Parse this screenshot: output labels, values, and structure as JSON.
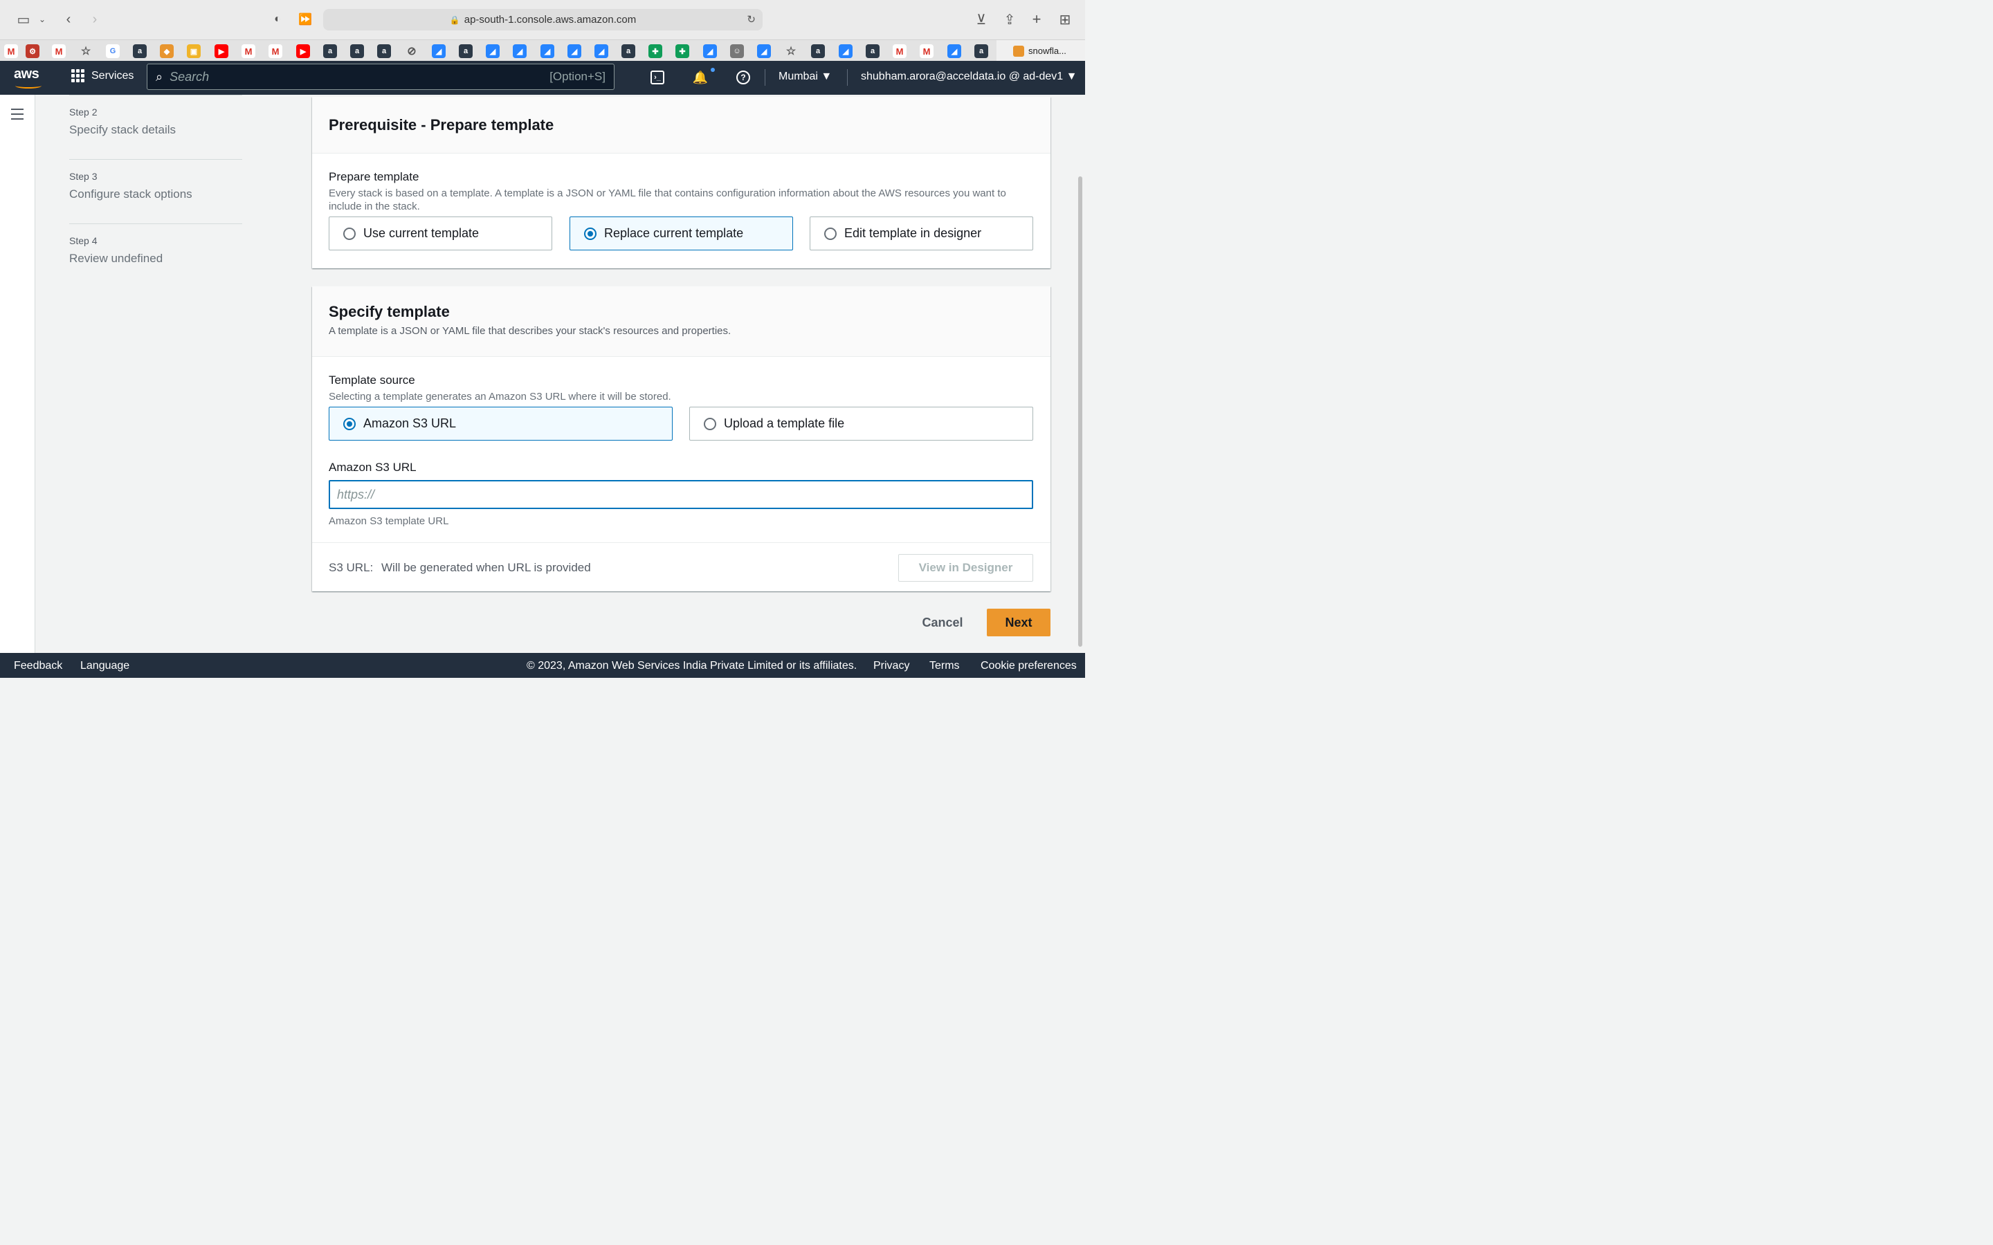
{
  "browser": {
    "url": "ap-south-1.console.aws.amazon.com",
    "active_tab_label": "snowfla..."
  },
  "aws_nav": {
    "logo_text": "aws",
    "services_label": "Services",
    "search_placeholder": "Search",
    "search_shortcut": "[Option+S]",
    "region": "Mumbai ▼",
    "account": "shubham.arora@acceldata.io @ ad-dev1 ▼"
  },
  "steps": [
    {
      "num": "Step 2",
      "title": "Specify stack details"
    },
    {
      "num": "Step 3",
      "title": "Configure stack options"
    },
    {
      "num": "Step 4",
      "title": "Review undefined"
    }
  ],
  "prerequisite": {
    "title": "Prerequisite - Prepare template",
    "label": "Prepare template",
    "desc": "Every stack is based on a template. A template is a JSON or YAML file that contains configuration information about the AWS resources you want to include in the stack.",
    "options": [
      {
        "label": "Use current template",
        "selected": false
      },
      {
        "label": "Replace current template",
        "selected": true
      },
      {
        "label": "Edit template in designer",
        "selected": false
      }
    ]
  },
  "specify": {
    "title": "Specify template",
    "desc": "A template is a JSON or YAML file that describes your stack's resources and properties.",
    "source_label": "Template source",
    "source_desc": "Selecting a template generates an Amazon S3 URL where it will be stored.",
    "options": [
      {
        "label": "Amazon S3 URL",
        "selected": true
      },
      {
        "label": "Upload a template file",
        "selected": false
      }
    ],
    "s3_label": "Amazon S3 URL",
    "s3_placeholder": "https://",
    "s3_hint": "Amazon S3 template URL",
    "s3url_label": "S3 URL:",
    "s3url_value": "Will be generated when URL is provided",
    "view_designer": "View in Designer"
  },
  "actions": {
    "cancel": "Cancel",
    "next": "Next"
  },
  "footer": {
    "feedback": "Feedback",
    "language": "Language",
    "copyright": "© 2023, Amazon Web Services India Private Limited or its affiliates.",
    "privacy": "Privacy",
    "terms": "Terms",
    "cookies": "Cookie preferences"
  },
  "colors": {
    "aws_nav_bg": "#232f3e",
    "selected_blue": "#0073bb",
    "primary_orange": "#ec972d"
  }
}
